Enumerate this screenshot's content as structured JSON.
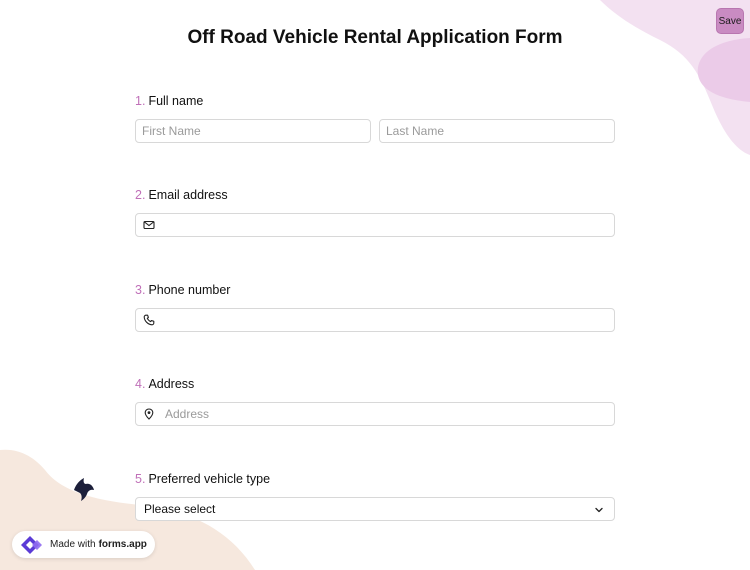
{
  "header": {
    "save_label": "Save",
    "title": "Off Road Vehicle Rental Application Form"
  },
  "questions": [
    {
      "number": "1.",
      "label": "Full name",
      "first_placeholder": "First Name",
      "last_placeholder": "Last Name"
    },
    {
      "number": "2.",
      "label": "Email address",
      "icon": "envelope-icon",
      "value": ""
    },
    {
      "number": "3.",
      "label": "Phone number",
      "icon": "phone-icon",
      "value": ""
    },
    {
      "number": "4.",
      "label": "Address",
      "icon": "map-pin-icon",
      "placeholder": "Address"
    },
    {
      "number": "5.",
      "label": "Preferred vehicle type",
      "selected": "Please select",
      "icon": "chevron-down-icon"
    }
  ],
  "branding": {
    "prefix": "Made with",
    "brand": "forms.app"
  },
  "colors": {
    "accent": "#c070b8",
    "save_bg": "#c98bc2",
    "blob_pink": "#f1dff0",
    "blob_peach": "#f5e6dc"
  }
}
